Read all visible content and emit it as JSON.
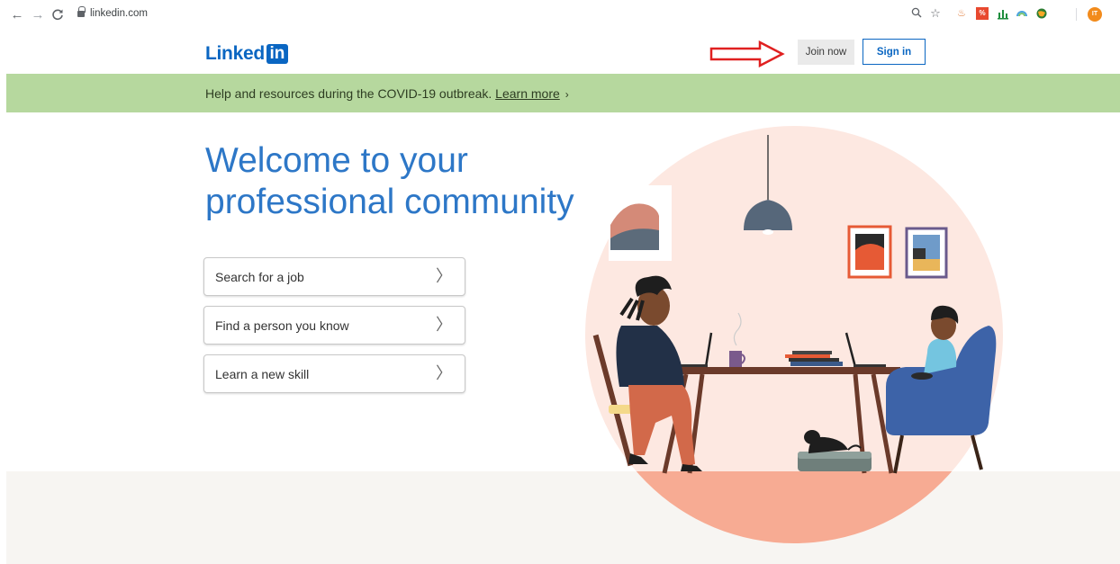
{
  "browser": {
    "url": "linkedin.com",
    "back_icon": "arrow-left-icon",
    "forward_icon": "arrow-right-icon",
    "reload_icon": "reload-icon",
    "profile_initials": "IT",
    "extensions": [
      "java-icon",
      "percent-extension-icon",
      "chart-extension-icon",
      "cloud-extension-icon",
      "globe-extension-icon"
    ]
  },
  "header": {
    "logo_text": "Linked",
    "logo_badge": "in",
    "join_label": "Join now",
    "signin_label": "Sign in"
  },
  "banner": {
    "text": "Help and resources during the COVID-19 outbreak. ",
    "link": "Learn more",
    "chevron": "›"
  },
  "hero": {
    "title_line1": "Welcome to your",
    "title_line2": "professional community"
  },
  "actions": [
    {
      "label": "Search for a job",
      "chevron": "〉"
    },
    {
      "label": "Find a person you know",
      "chevron": "〉"
    },
    {
      "label": "Learn a new skill",
      "chevron": "〉"
    }
  ],
  "colors": {
    "brand": "#0a66c2",
    "headline": "#2d77c7",
    "banner": "#b6d89e",
    "annotation_arrow": "#e02020"
  }
}
